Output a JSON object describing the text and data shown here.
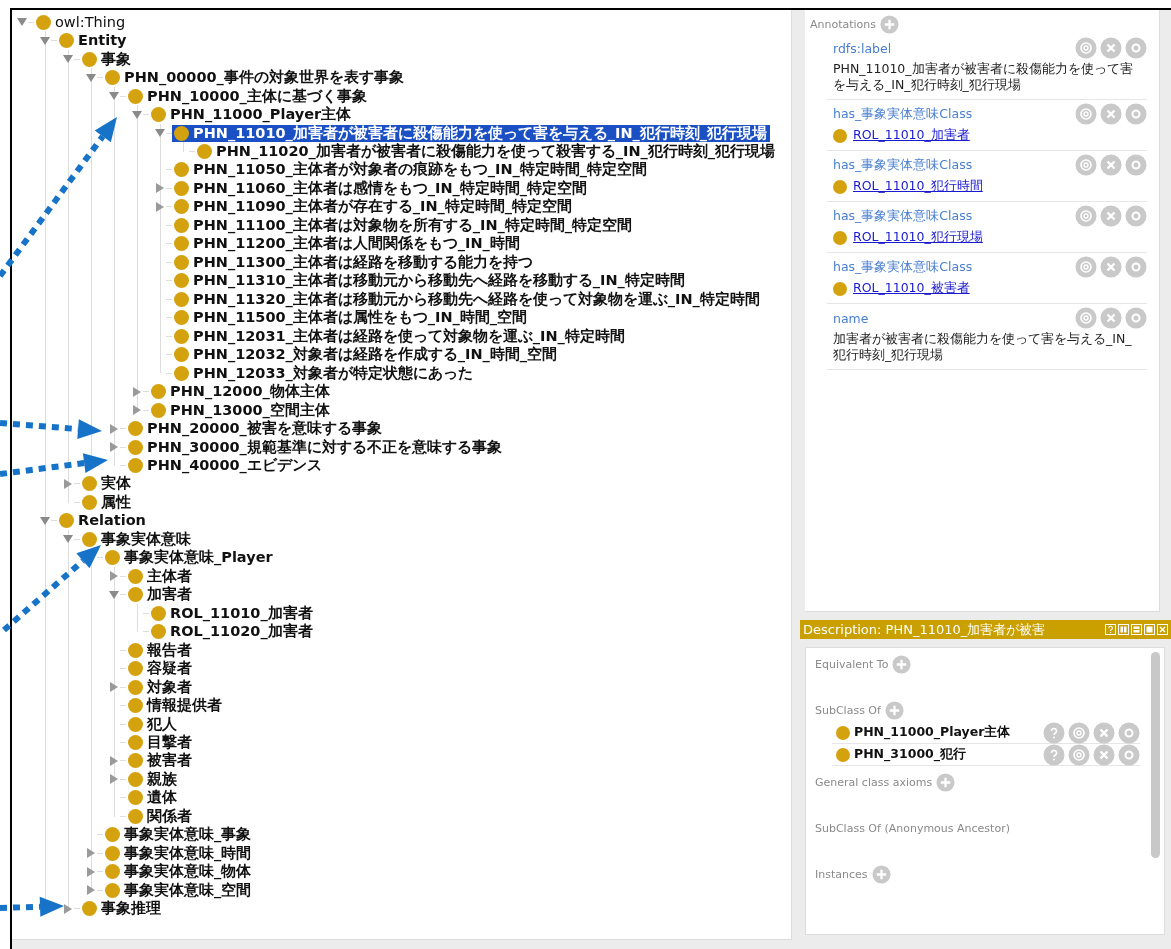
{
  "tree": {
    "root": {
      "label": "owl:Thing",
      "selected": false,
      "expanded": true,
      "children": [
        {
          "label": "Entity",
          "selected": false,
          "expanded": true,
          "children": [
            {
              "label": "事象",
              "selected": false,
              "expanded": true,
              "children": [
                {
                  "label": "PHN_00000_事件の対象世界を表す事象",
                  "selected": false,
                  "expanded": true,
                  "children": [
                    {
                      "label": "PHN_10000_主体に基づく事象",
                      "selected": false,
                      "expanded": true,
                      "children": [
                        {
                          "label": "PHN_11000_Player主体",
                          "selected": false,
                          "expanded": true,
                          "children": [
                            {
                              "label": "PHN_11010_加害者が被害者に殺傷能力を使って害を与える_IN_犯行時刻_犯行現場",
                              "selected": true,
                              "expanded": true,
                              "children": [
                                {
                                  "label": "PHN_11020_加害者が被害者に殺傷能力を使って殺害する_IN_犯行時刻_犯行現場",
                                  "selected": false
                                }
                              ]
                            },
                            {
                              "label": "PHN_11050_主体者が対象者の痕跡をもつ_IN_特定時間_特定空間",
                              "selected": false
                            },
                            {
                              "label": "PHN_11060_主体者は感情をもつ_IN_特定時間_特定空間",
                              "selected": false,
                              "expanded": false
                            },
                            {
                              "label": "PHN_11090_主体者が存在する_IN_特定時間_特定空間",
                              "selected": false,
                              "expanded": false
                            },
                            {
                              "label": "PHN_11100_主体者は対象物を所有する_IN_特定時間_特定空間",
                              "selected": false
                            },
                            {
                              "label": "PHN_11200_主体者は人間関係をもつ_IN_時間",
                              "selected": false
                            },
                            {
                              "label": "PHN_11300_主体者は経路を移動する能力を持つ",
                              "selected": false
                            },
                            {
                              "label": "PHN_11310_主体者は移動元から移動先へ経路を移動する_IN_特定時間",
                              "selected": false
                            },
                            {
                              "label": "PHN_11320_主体者は移動元から移動先へ経路を使って対象物を運ぶ_IN_特定時間",
                              "selected": false
                            },
                            {
                              "label": "PHN_11500_主体者は属性をもつ_IN_時間_空間",
                              "selected": false
                            },
                            {
                              "label": "PHN_12031_主体者は経路を使って対象物を運ぶ_IN_特定時間",
                              "selected": false
                            },
                            {
                              "label": "PHN_12032_対象者は経路を作成する_IN_時間_空間",
                              "selected": false
                            },
                            {
                              "label": "PHN_12033_対象者が特定状態にあった",
                              "selected": false
                            }
                          ]
                        },
                        {
                          "label": "PHN_12000_物体主体",
                          "selected": false,
                          "expanded": false
                        },
                        {
                          "label": "PHN_13000_空間主体",
                          "selected": false,
                          "expanded": false
                        }
                      ]
                    },
                    {
                      "label": "PHN_20000_被害を意味する事象",
                      "selected": false,
                      "expanded": false
                    },
                    {
                      "label": "PHN_30000_規範基準に対する不正を意味する事象",
                      "selected": false,
                      "expanded": false
                    },
                    {
                      "label": "PHN_40000_エビデンス",
                      "selected": false
                    }
                  ]
                }
              ]
            },
            {
              "label": "実体",
              "selected": false,
              "expanded": false
            },
            {
              "label": "属性",
              "selected": false
            }
          ]
        },
        {
          "label": "Relation",
          "selected": false,
          "expanded": true,
          "children": [
            {
              "label": "事象実体意味",
              "selected": false,
              "expanded": true,
              "children": [
                {
                  "label": "事象実体意味_Player",
                  "selected": false,
                  "children": [
                    {
                      "label": "主体者",
                      "selected": false,
                      "expanded": false
                    },
                    {
                      "label": "加害者",
                      "selected": false,
                      "expanded": true,
                      "children": [
                        {
                          "label": "ROL_11010_加害者",
                          "selected": false
                        },
                        {
                          "label": "ROL_11020_加害者",
                          "selected": false
                        }
                      ]
                    },
                    {
                      "label": "報告者",
                      "selected": false
                    },
                    {
                      "label": "容疑者",
                      "selected": false
                    },
                    {
                      "label": "対象者",
                      "selected": false,
                      "expanded": false
                    },
                    {
                      "label": "情報提供者",
                      "selected": false
                    },
                    {
                      "label": "犯人",
                      "selected": false
                    },
                    {
                      "label": "目撃者",
                      "selected": false
                    },
                    {
                      "label": "被害者",
                      "selected": false,
                      "expanded": false
                    },
                    {
                      "label": "親族",
                      "selected": false,
                      "expanded": false
                    },
                    {
                      "label": "遺体",
                      "selected": false
                    },
                    {
                      "label": "関係者",
                      "selected": false
                    }
                  ]
                },
                {
                  "label": "事象実体意味_事象",
                  "selected": false
                },
                {
                  "label": "事象実体意味_時間",
                  "selected": false,
                  "expanded": false
                },
                {
                  "label": "事象実体意味_物体",
                  "selected": false,
                  "expanded": false
                },
                {
                  "label": "事象実体意味_空間",
                  "selected": false,
                  "expanded": false
                }
              ]
            },
            {
              "label": "事象推理",
              "selected": false,
              "expanded": false
            }
          ]
        }
      ]
    }
  },
  "annotations": {
    "title": "Annotations",
    "items": [
      {
        "kind": "text",
        "property": "rdfs:label",
        "value": "PHN_11010_加害者が被害者に殺傷能力を使って害を与える_IN_犯行時刻_犯行現場"
      },
      {
        "kind": "link",
        "property": "has_事象実体意味Class",
        "value": "ROL_11010_加害者"
      },
      {
        "kind": "link",
        "property": "has_事象実体意味Class",
        "value": "ROL_11010_犯行時間"
      },
      {
        "kind": "link",
        "property": "has_事象実体意味Class",
        "value": "ROL_11010_犯行現場"
      },
      {
        "kind": "link",
        "property": "has_事象実体意味Class",
        "value": "ROL_11010_被害者"
      },
      {
        "kind": "text",
        "property": "name",
        "value": "加害者が被害者に殺傷能力を使って害を与える_IN_犯行時刻_犯行現場"
      }
    ]
  },
  "description": {
    "title": "Description: PHN_11010_加害者が被害",
    "sections": [
      {
        "title": "Equivalent To",
        "addable": true
      },
      {
        "title": "SubClass Of",
        "addable": true,
        "items": [
          {
            "label": "PHN_11000_Player主体"
          },
          {
            "label": "PHN_31000_犯行"
          }
        ]
      },
      {
        "title": "General class axioms",
        "addable": true
      },
      {
        "title": "SubClass Of (Anonymous Ancestor)",
        "addable": false
      },
      {
        "title": "Instances",
        "addable": true
      }
    ]
  }
}
